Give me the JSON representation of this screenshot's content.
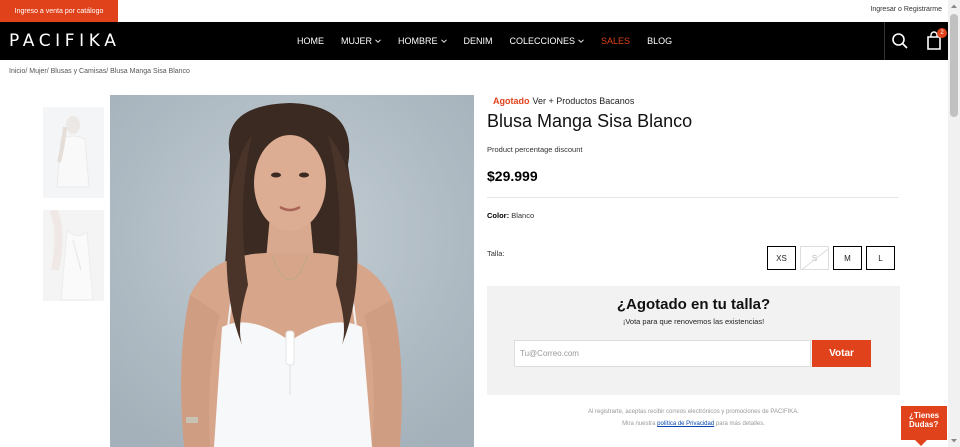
{
  "topbar": {
    "catalog_label": "Ingreso a venta por catálogo",
    "login_label": "Ingresar",
    "separator": "o",
    "register_label": "Registrarme"
  },
  "navbar": {
    "logo": "PACIFIKA",
    "items": [
      {
        "label": "HOME",
        "has_dropdown": false
      },
      {
        "label": "MUJER",
        "has_dropdown": true
      },
      {
        "label": "HOMBRE",
        "has_dropdown": true
      },
      {
        "label": "DENIM",
        "has_dropdown": false
      },
      {
        "label": "COLECCIONES",
        "has_dropdown": true
      },
      {
        "label": "SALES",
        "has_dropdown": false
      },
      {
        "label": "BLOG",
        "has_dropdown": false
      }
    ],
    "cart_count": "2",
    "search_icon": "search-icon",
    "cart_icon": "shopping-bag-icon"
  },
  "breadcrumb": {
    "items": [
      "Inicio",
      "Mujer",
      "Blusas y Camisas"
    ],
    "current": "Blusa Manga Sisa Blanco"
  },
  "product": {
    "status": "Agotado",
    "more_link": "Ver + Productos Bacanos",
    "title": "Blusa Manga Sisa Blanco",
    "discount_text": "Product percentage discount",
    "price": "$29.999",
    "color_label": "Color:",
    "color_value": "Blanco",
    "size_label": "Talla:",
    "sizes": [
      {
        "label": "XS",
        "available": true
      },
      {
        "label": "S",
        "available": false
      },
      {
        "label": "M",
        "available": true
      },
      {
        "label": "L",
        "available": true
      }
    ]
  },
  "notify": {
    "title": "¿Agotado en tu talla?",
    "subtitle": "¡Vota para que renovemos las existencias!",
    "email_placeholder": "Tu@Correo.com",
    "vote_label": "Votar",
    "legal_line1": "Al registrarte, aceptas recibir correos electrónicos y promociones de PACIFIKA.",
    "legal_prefix": "Mira nuestra",
    "privacy_link": "política de Privacidad",
    "legal_suffix": "para más detalles."
  },
  "help": {
    "line1": "¿Tienes",
    "line2": "Dudas?"
  },
  "colors": {
    "accent": "#e0421b",
    "nav_bg": "#000000",
    "notify_bg": "#f2f2f2"
  }
}
